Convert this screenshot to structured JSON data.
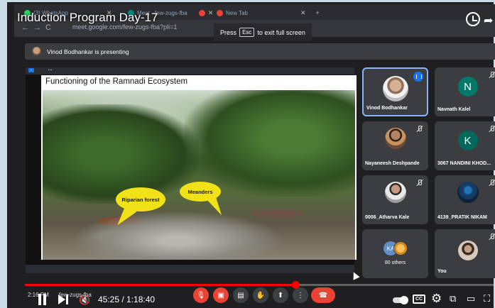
{
  "browser": {
    "tabs": [
      {
        "label": "(3) WhatsApp",
        "color": "#25d366"
      },
      {
        "label": "Meet - few-zugs-fba",
        "color": "#00897b"
      },
      {
        "label": "New Tab",
        "color": "#ea4335"
      }
    ],
    "url": "meet.google.com/few-zugs-fba?pli=1"
  },
  "video": {
    "title": "Induction Program Day-17",
    "esc_toast": {
      "prefix": "Press",
      "key": "Esc",
      "suffix": "to exit full screen"
    }
  },
  "meet": {
    "presenter_banner": "Vinod Bodhankar is presenting",
    "slide": {
      "title": "Functioning of the Ramnadi Ecosystem",
      "callouts": [
        {
          "label": "Riparian forest"
        },
        {
          "label": "Meanders"
        }
      ]
    },
    "participants": [
      {
        "name": "Vinod Bodhankar",
        "avatar": "photo",
        "speaking": true
      },
      {
        "name": "Navnath Kalel",
        "avatar": "letter",
        "letter": "N",
        "color": "#00796b",
        "muted": true
      },
      {
        "name": "Nayaneesh Deshpande",
        "avatar": "photo",
        "muted": true
      },
      {
        "name": "3067 NANDINI KHOD...",
        "avatar": "letter",
        "letter": "K",
        "color": "#00695c",
        "muted": true
      },
      {
        "name": "0006_Atharva Kale",
        "avatar": "photo",
        "muted": true
      },
      {
        "name": "4139_PRATIK NIKAM",
        "avatar": "photo",
        "muted": true
      },
      {
        "name": "80 others",
        "avatar": "group",
        "initials": "KA"
      },
      {
        "name": "You",
        "avatar": "photo",
        "muted": true
      }
    ],
    "overlay_clock": "2:16 PM",
    "overlay_code": "few-zugs-fba"
  },
  "player": {
    "time": "45:25 / 1:18:40",
    "progress": 0.577,
    "buffered": 0.62,
    "accent": "#ff0000"
  }
}
